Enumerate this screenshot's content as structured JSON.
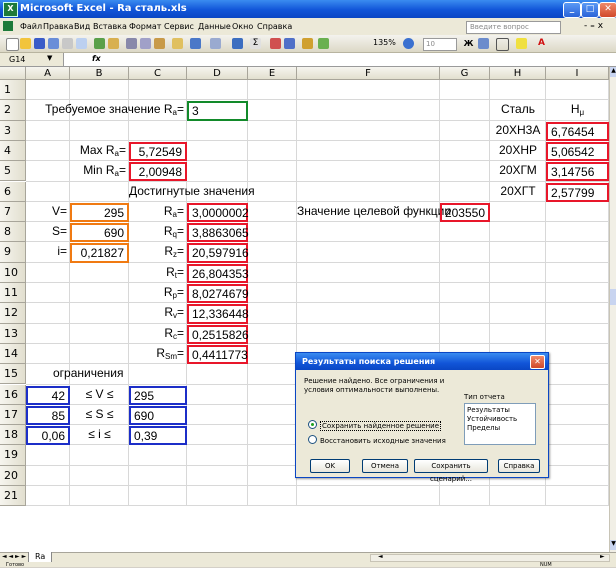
{
  "window": {
    "title": "Microsoft Excel - Ra сталь.xls",
    "app_icon": "X"
  },
  "menu": {
    "items": [
      "Файл",
      "Правка",
      "Вид",
      "Вставка",
      "Формат",
      "Сервис",
      "Данные",
      "Окно",
      "Справка"
    ],
    "ask_placeholder": "Введите вопрос"
  },
  "toolbar": {
    "zoom": "135%",
    "font_size": "10"
  },
  "formula_bar": {
    "name_box": "G14",
    "fx": "fx",
    "value": ""
  },
  "grid": {
    "columns": [
      "A",
      "B",
      "C",
      "D",
      "E",
      "F",
      "G",
      "H",
      "I"
    ],
    "rows": [
      "1",
      "2",
      "3",
      "4",
      "5",
      "6",
      "7",
      "8",
      "9",
      "10",
      "11",
      "12",
      "13",
      "14",
      "15",
      "16",
      "17",
      "18",
      "19",
      "20",
      "21"
    ]
  },
  "cells": {
    "req_label": "Требуемое значение R",
    "req_label_sub": "a",
    "req_label_end": "=",
    "req_value": "3",
    "max_label": "Max R",
    "max_label_sub": "a",
    "max_label_end": "=",
    "max_value": "5,72549",
    "min_label": "Min R",
    "min_label_sub": "a",
    "min_label_end": "=",
    "min_value": "2,00948",
    "achieved_title": "Достигнутые значения",
    "v_label": "V=",
    "v_value": "295",
    "s_label": "S=",
    "s_value": "690",
    "i_label": "i=",
    "i_value": "0,21827",
    "params": [
      {
        "name": "R",
        "sub": "a",
        "value": "3,0000002"
      },
      {
        "name": "R",
        "sub": "q",
        "value": "3,8863065"
      },
      {
        "name": "R",
        "sub": "z",
        "value": "20,597916"
      },
      {
        "name": "R",
        "sub": "t",
        "value": "26,804353"
      },
      {
        "name": "R",
        "sub": "p",
        "value": "8,0274679"
      },
      {
        "name": "R",
        "sub": "v",
        "value": "12,336448"
      },
      {
        "name": "R",
        "sub": "c",
        "value": "0,2515826"
      },
      {
        "name": "R",
        "sub": "Sm",
        "value": "0,4411773"
      }
    ],
    "target_label": "Значение целевой функции",
    "target_value": "203550",
    "steel_header": "Сталь",
    "hu_header": "H",
    "hu_sub": "μ",
    "steels": [
      {
        "name": "20ХН3А",
        "value": "6,76454"
      },
      {
        "name": "20ХНР",
        "value": "5,06542"
      },
      {
        "name": "20ХГМ",
        "value": "3,14756"
      },
      {
        "name": "20ХГТ",
        "value": "2,57799"
      }
    ],
    "constraints_title": "ограничения",
    "constraints": [
      {
        "low": "42",
        "rel": "≤ V ≤",
        "high": "295"
      },
      {
        "low": "85",
        "rel": "≤ S ≤",
        "high": "690"
      },
      {
        "low": "0,06",
        "rel": "≤ i ≤",
        "high": "0,39"
      }
    ]
  },
  "sheet_tabs": {
    "nav": "◄ ◄ ► ►",
    "active": "Ra"
  },
  "status": {
    "left": "Готово",
    "right": "NUM"
  },
  "dialog": {
    "title": "Результаты поиска решения",
    "message": "Решение найдено. Все ограничения и условия оптимальности выполнены.",
    "report_type_label": "Тип отчета",
    "reports": [
      "Результаты",
      "Устойчивость",
      "Пределы"
    ],
    "option_keep": "Сохранить найденное решение",
    "option_restore": "Восстановить исходные значения",
    "ok": "OK",
    "cancel": "Отмена",
    "save_scenario": "Сохранить сценарий...",
    "help": "Справка"
  },
  "colors": {
    "red": "#e8162a",
    "green": "#128a2a",
    "orange": "#f07a12",
    "blue": "#1c2ec8",
    "titlebar": "#1155d8"
  }
}
